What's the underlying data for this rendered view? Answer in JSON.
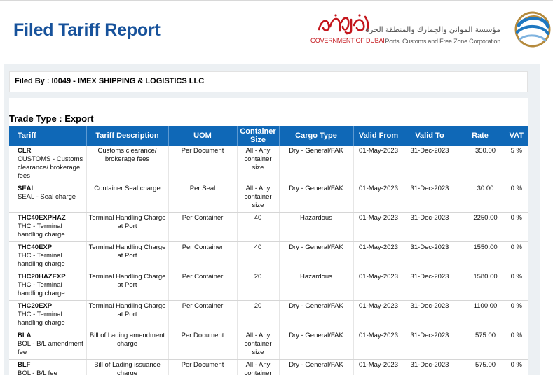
{
  "report": {
    "title": "Filed Tariff Report"
  },
  "logos": {
    "government": {
      "arabic_script": "حكومة دبي",
      "text": "GOVERNMENT OF DUBAI"
    },
    "pcfc": {
      "arabic": "مؤسسة الموانئ والجمارك والمنطقة الحرة",
      "english": "Ports, Customs and Free Zone Corporation"
    }
  },
  "filed_by": "Filed By : I0049 - IMEX SHIPPING & LOGISTICS LLC",
  "trade_type": "Trade Type : Export",
  "table": {
    "headers": {
      "tariff": "Tariff",
      "description": "Tariff Description",
      "uom": "UOM",
      "container_size": "Container Size",
      "cargo_type": "Cargo Type",
      "valid_from": "Valid From",
      "valid_to": "Valid To",
      "rate": "Rate",
      "vat": "VAT"
    },
    "rows": [
      {
        "code": "CLR",
        "code_desc": "CUSTOMS - Customs clearance/ brokerage fees",
        "description": "Customs clearance/ brokerage fees",
        "uom": "Per Document",
        "container_size": "All - Any container size",
        "cargo_type": "Dry - General/FAK",
        "valid_from": "01-May-2023",
        "valid_to": "31-Dec-2023",
        "rate": "350.00",
        "vat": "5 %"
      },
      {
        "code": "SEAL",
        "code_desc": "SEAL - Seal charge",
        "description": "Container Seal charge",
        "uom": "Per Seal",
        "container_size": "All - Any container size",
        "cargo_type": "Dry - General/FAK",
        "valid_from": "01-May-2023",
        "valid_to": "31-Dec-2023",
        "rate": "30.00",
        "vat": "0 %"
      },
      {
        "code": "THC40EXPHAZ",
        "code_desc": "THC - Terminal handling charge",
        "description": "Terminal Handling Charge at Port",
        "uom": "Per Container",
        "container_size": "40",
        "cargo_type": "Hazardous",
        "valid_from": "01-May-2023",
        "valid_to": "31-Dec-2023",
        "rate": "2250.00",
        "vat": "0 %"
      },
      {
        "code": "THC40EXP",
        "code_desc": "THC - Terminal handling charge",
        "description": "Terminal Handling Charge at Port",
        "uom": "Per Container",
        "container_size": "40",
        "cargo_type": "Dry - General/FAK",
        "valid_from": "01-May-2023",
        "valid_to": "31-Dec-2023",
        "rate": "1550.00",
        "vat": "0 %"
      },
      {
        "code": "THC20HAZEXP",
        "code_desc": "THC - Terminal handling charge",
        "description": "Terminal Handling Charge at Port",
        "uom": "Per Container",
        "container_size": "20",
        "cargo_type": "Hazardous",
        "valid_from": "01-May-2023",
        "valid_to": "31-Dec-2023",
        "rate": "1580.00",
        "vat": "0 %"
      },
      {
        "code": "THC20EXP",
        "code_desc": "THC - Terminal handling charge",
        "description": "Terminal Handling Charge at Port",
        "uom": "Per Container",
        "container_size": "20",
        "cargo_type": "Dry - General/FAK",
        "valid_from": "01-May-2023",
        "valid_to": "31-Dec-2023",
        "rate": "1100.00",
        "vat": "0 %"
      },
      {
        "code": "BLA",
        "code_desc": "BOL - B/L amendment fee",
        "description": "Bill of Lading amendment charge",
        "uom": "Per Document",
        "container_size": "All - Any container size",
        "cargo_type": "Dry - General/FAK",
        "valid_from": "01-May-2023",
        "valid_to": "31-Dec-2023",
        "rate": "575.00",
        "vat": "0 %"
      },
      {
        "code": "BLF",
        "code_desc": "BOL - B/L fee",
        "description": "Bill of Lading issuance charge",
        "uom": "Per Document",
        "container_size": "All - Any container size",
        "cargo_type": "Dry - General/FAK",
        "valid_from": "01-May-2023",
        "valid_to": "31-Dec-2023",
        "rate": "575.00",
        "vat": "0 %"
      }
    ]
  },
  "colors": {
    "title": "#17529b",
    "header_bg": "#0f68b7",
    "gov_red": "#c4161c",
    "panel_bg": "#ecf0f3"
  }
}
